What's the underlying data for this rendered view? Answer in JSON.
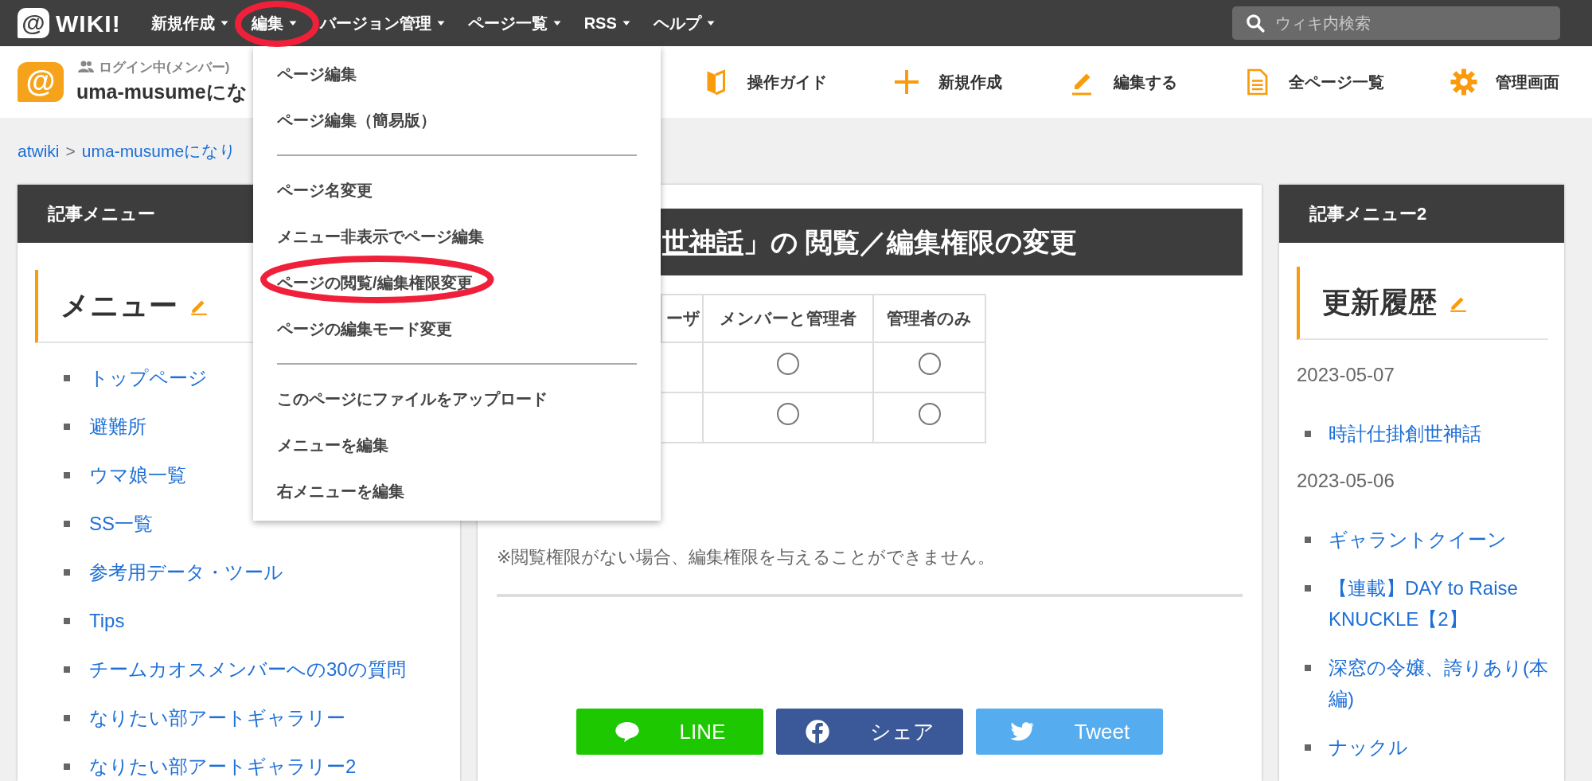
{
  "top_nav": {
    "logo": {
      "mark": "@",
      "text": "WIKI!"
    },
    "items": [
      {
        "label": "新規作成",
        "circled": false
      },
      {
        "label": "編集",
        "circled": true
      },
      {
        "label": "バージョン管理",
        "circled": false
      },
      {
        "label": "ページ一覧",
        "circled": false
      },
      {
        "label": "RSS",
        "circled": false
      },
      {
        "label": "ヘルプ",
        "circled": false
      }
    ],
    "search": {
      "placeholder": "ウィキ内検索"
    }
  },
  "site_header": {
    "avatar_mark": "@",
    "login_status": "ログイン中(メンバー)",
    "site_title": "uma-musumeにな",
    "tools": [
      {
        "label": "操作ガイド",
        "kind": "guide"
      },
      {
        "label": "新規作成",
        "kind": "new"
      },
      {
        "label": "編集する",
        "kind": "edit"
      },
      {
        "label": "全ページ一覧",
        "kind": "pages"
      },
      {
        "label": "管理画面",
        "kind": "admin"
      }
    ]
  },
  "dropdown": {
    "groups": [
      [
        {
          "label": "ページ編集",
          "circled": false
        },
        {
          "label": "ページ編集（簡易版）",
          "circled": false
        }
      ],
      [
        {
          "label": "ページ名変更",
          "circled": false
        },
        {
          "label": "メニュー非表示でページ編集",
          "circled": false
        },
        {
          "label": "ページの閲覧/編集権限変更",
          "circled": true
        },
        {
          "label": "ページの編集モード変更",
          "circled": false
        }
      ],
      [
        {
          "label": "このページにファイルをアップロード",
          "circled": false
        },
        {
          "label": "メニューを編集",
          "circled": false
        },
        {
          "label": "右メニューを編集",
          "circled": false
        }
      ]
    ]
  },
  "breadcrumb": {
    "items": [
      "atwiki",
      "uma-musumeになり"
    ],
    "separator": ">"
  },
  "left_panel": {
    "title": "記事メニュー",
    "heading": "メニュー",
    "links": [
      "トップページ",
      "避難所",
      "ウマ娘一覧",
      "SS一覧",
      "参考用データ・ツール",
      "Tips",
      "チームカオスメンバーへの30の質問",
      "なりたい部アートギャラリー",
      "なりたい部アートギャラリー2"
    ]
  },
  "main": {
    "heading_link": "世神話",
    "heading_rest": "」の 閲覧／編集権限の変更",
    "table": {
      "columns": [
        "ーザ",
        "メンバーと管理者",
        "管理者のみ"
      ],
      "rows": [
        {
          "cells": [
            {
              "kind": "blank"
            },
            {
              "kind": "radio",
              "selected": false
            },
            {
              "kind": "radio",
              "selected": false
            }
          ]
        },
        {
          "cells": [
            {
              "kind": "blank"
            },
            {
              "kind": "radio",
              "selected": false
            },
            {
              "kind": "radio",
              "selected": false
            }
          ]
        }
      ]
    },
    "note": "※閲覧権限がない場合、編集権限を与えることができません。",
    "share_buttons": [
      {
        "label": "LINE",
        "kind": "line"
      },
      {
        "label": "シェア",
        "kind": "facebook"
      },
      {
        "label": "Tweet",
        "kind": "twitter"
      }
    ]
  },
  "right_panel": {
    "title": "記事メニュー2",
    "heading": "更新履歴",
    "groups": [
      {
        "date": "2023-05-07",
        "links": [
          "時計仕掛創世神話"
        ]
      },
      {
        "date": "2023-05-06",
        "links": [
          "ギャラントクイーン",
          "【連載】DAY to Raise KNUCKLE【2】",
          "深窓の令嬢、誇りあり(本編)",
          "ナックル"
        ]
      }
    ]
  }
}
